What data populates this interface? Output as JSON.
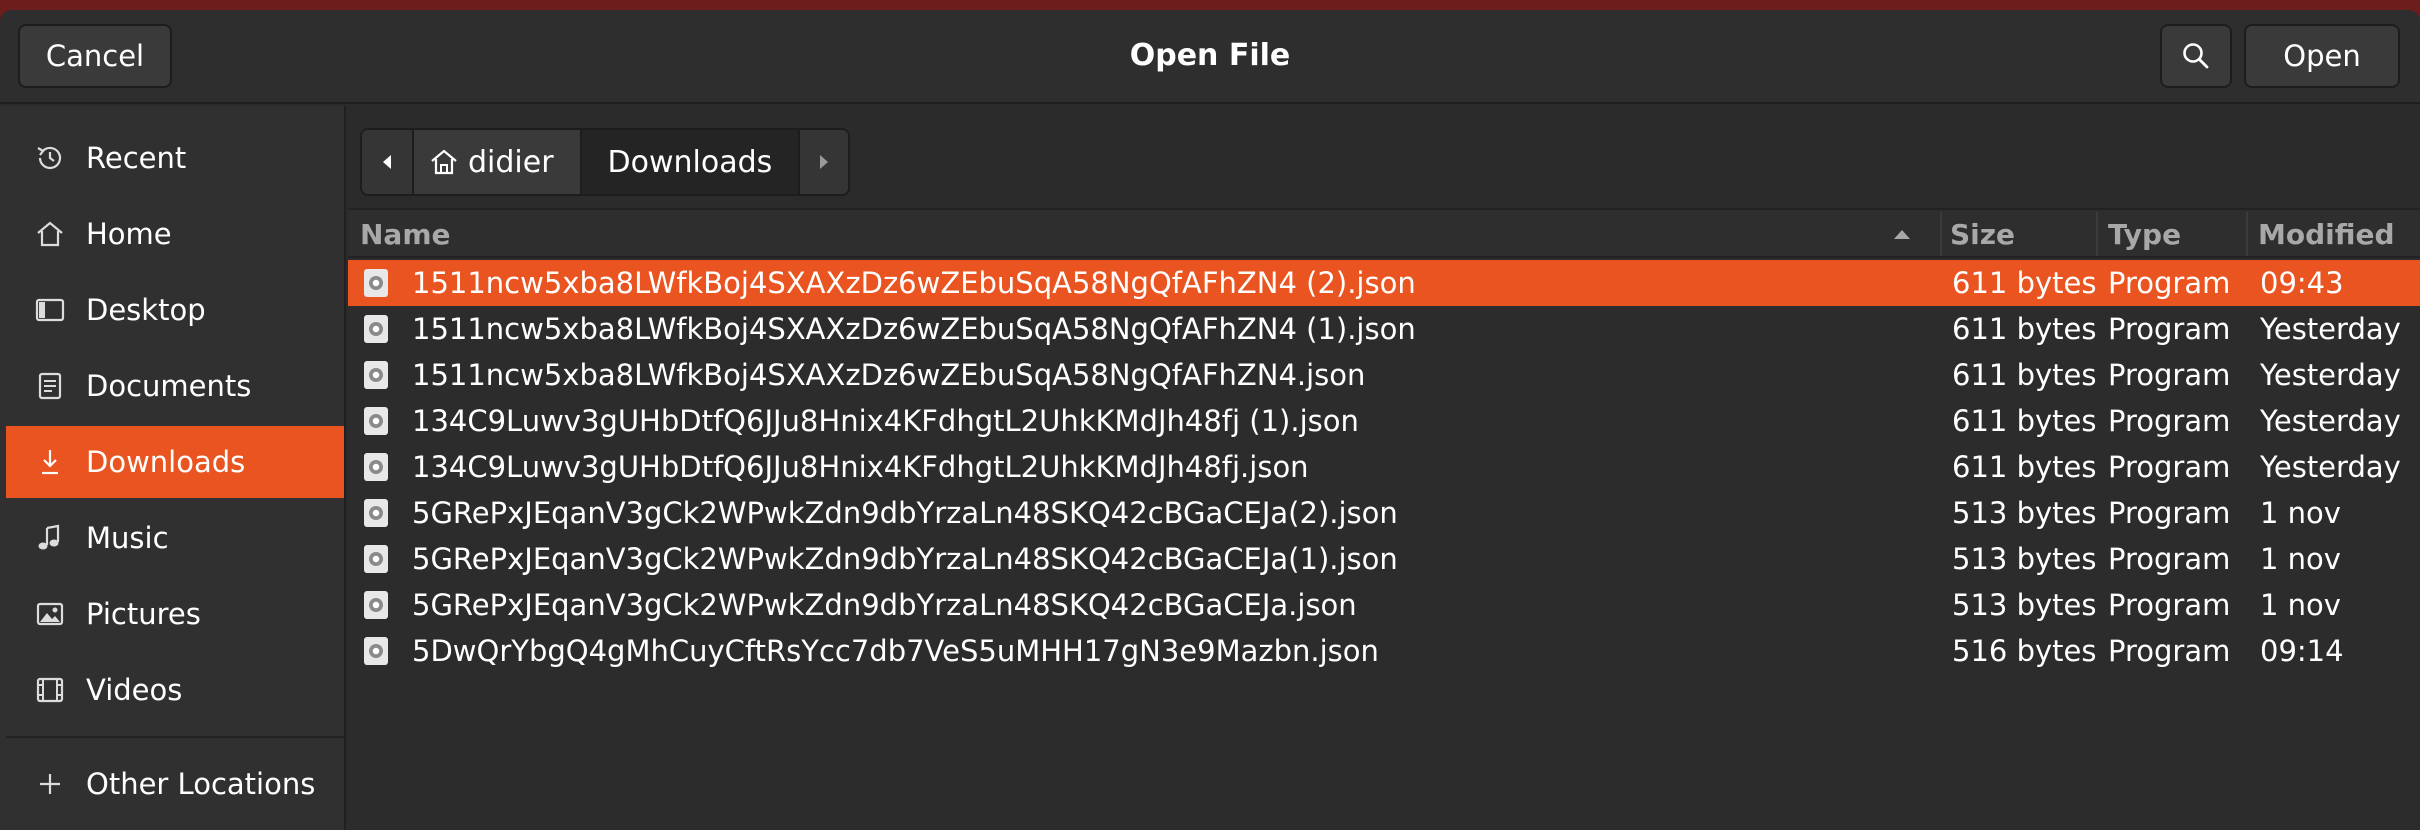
{
  "header": {
    "title": "Open File",
    "cancel_label": "Cancel",
    "open_label": "Open",
    "search_icon": "search-icon"
  },
  "sidebar": {
    "items": [
      {
        "label": "Recent",
        "icon": "clock-icon",
        "active": false
      },
      {
        "label": "Home",
        "icon": "home-icon",
        "active": false
      },
      {
        "label": "Desktop",
        "icon": "desktop-icon",
        "active": false
      },
      {
        "label": "Documents",
        "icon": "document-icon",
        "active": false
      },
      {
        "label": "Downloads",
        "icon": "download-icon",
        "active": true
      },
      {
        "label": "Music",
        "icon": "music-note-icon",
        "active": false
      },
      {
        "label": "Pictures",
        "icon": "picture-icon",
        "active": false
      },
      {
        "label": "Videos",
        "icon": "film-icon",
        "active": false
      }
    ],
    "other_locations": "Other Locations"
  },
  "pathbar": {
    "home_label": "didier",
    "current_label": "Downloads"
  },
  "columns": {
    "name": "Name",
    "size": "Size",
    "type": "Type",
    "modified": "Modified"
  },
  "files": [
    {
      "name": "1511ncw5xba8LWfkBoj4SXAXzDz6wZEbuSqA58NgQfAFhZN4 (2).json",
      "size": "611 bytes",
      "type": "Program",
      "modified": "09:43",
      "selected": true
    },
    {
      "name": "1511ncw5xba8LWfkBoj4SXAXzDz6wZEbuSqA58NgQfAFhZN4 (1).json",
      "size": "611 bytes",
      "type": "Program",
      "modified": "Yesterday",
      "selected": false
    },
    {
      "name": "1511ncw5xba8LWfkBoj4SXAXzDz6wZEbuSqA58NgQfAFhZN4.json",
      "size": "611 bytes",
      "type": "Program",
      "modified": "Yesterday",
      "selected": false
    },
    {
      "name": "134C9Luwv3gUHbDtfQ6JJu8Hnix4KFdhgtL2UhkKMdJh48fj (1).json",
      "size": "611 bytes",
      "type": "Program",
      "modified": "Yesterday",
      "selected": false
    },
    {
      "name": "134C9Luwv3gUHbDtfQ6JJu8Hnix4KFdhgtL2UhkKMdJh48fj.json",
      "size": "611 bytes",
      "type": "Program",
      "modified": "Yesterday",
      "selected": false
    },
    {
      "name": "5GRePxJEqanV3gCk2WPwkZdn9dbYrzaLn48SKQ42cBGaCEJa(2).json",
      "size": "513 bytes",
      "type": "Program",
      "modified": "1 nov",
      "selected": false
    },
    {
      "name": "5GRePxJEqanV3gCk2WPwkZdn9dbYrzaLn48SKQ42cBGaCEJa(1).json",
      "size": "513 bytes",
      "type": "Program",
      "modified": "1 nov",
      "selected": false
    },
    {
      "name": "5GRePxJEqanV3gCk2WPwkZdn9dbYrzaLn48SKQ42cBGaCEJa.json",
      "size": "513 bytes",
      "type": "Program",
      "modified": "1 nov",
      "selected": false
    },
    {
      "name": "5DwQrYbgQ4gMhCuyCftRsYcc7db7VeS5uMHH17gN3e9Mazbn.json",
      "size": "516 bytes",
      "type": "Program",
      "modified": "09:14",
      "selected": false
    }
  ],
  "colors": {
    "accent": "#e95420",
    "background": "#2b2b2b"
  }
}
